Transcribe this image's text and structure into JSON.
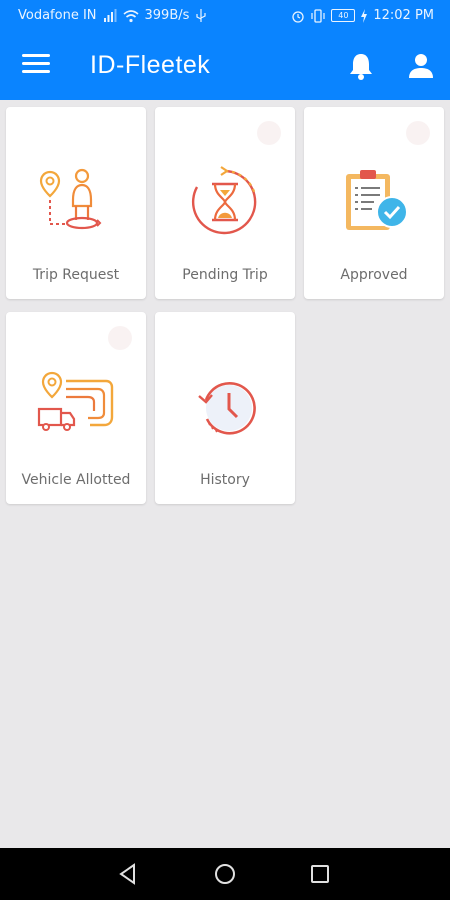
{
  "status_bar": {
    "carrier": "Vodafone IN",
    "speed": "399B/s",
    "battery": "40",
    "time": "12:02 PM"
  },
  "app_bar": {
    "title": "ID-Fleetek"
  },
  "tiles": [
    {
      "label": "Trip Request",
      "icon": "trip-request-icon"
    },
    {
      "label": "Pending Trip",
      "icon": "hourglass-icon"
    },
    {
      "label": "Approved",
      "icon": "approved-clipboard-icon"
    },
    {
      "label": "Vehicle Allotted",
      "icon": "vehicle-route-icon"
    },
    {
      "label": "History",
      "icon": "history-clock-icon"
    }
  ],
  "colors": {
    "primary": "#0a84ff",
    "background": "#e9e8ea",
    "tile_text": "#6d6d6d",
    "icon_orange": "#f39a3c",
    "icon_red": "#e2574c"
  }
}
